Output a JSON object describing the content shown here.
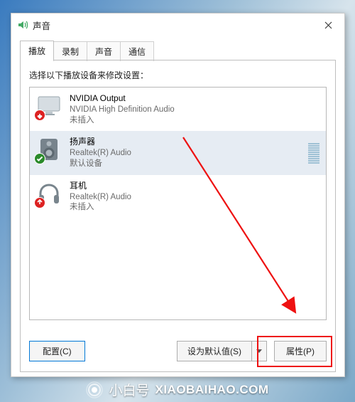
{
  "window": {
    "title": "声音"
  },
  "tabs": {
    "playback": "播放",
    "recording": "录制",
    "sounds": "声音",
    "communications": "通信"
  },
  "instruction": "选择以下播放设备来修改设置：",
  "devices": {
    "d0": {
      "name": "NVIDIA Output",
      "sub": "NVIDIA High Definition Audio",
      "status": "未插入"
    },
    "d1": {
      "name": "扬声器",
      "sub": "Realtek(R) Audio",
      "status": "默认设备"
    },
    "d2": {
      "name": "耳机",
      "sub": "Realtek(R) Audio",
      "status": "未插入"
    }
  },
  "buttons": {
    "configure": "配置(C)",
    "set_default": "设为默认值(S)",
    "properties": "属性(P)"
  },
  "brand": {
    "cn": "小白号",
    "en": "XIAOBAIHAO.COM"
  },
  "watermark": {
    "a": "@小白号",
    "b": "XIAOBAIHAO.COM"
  }
}
